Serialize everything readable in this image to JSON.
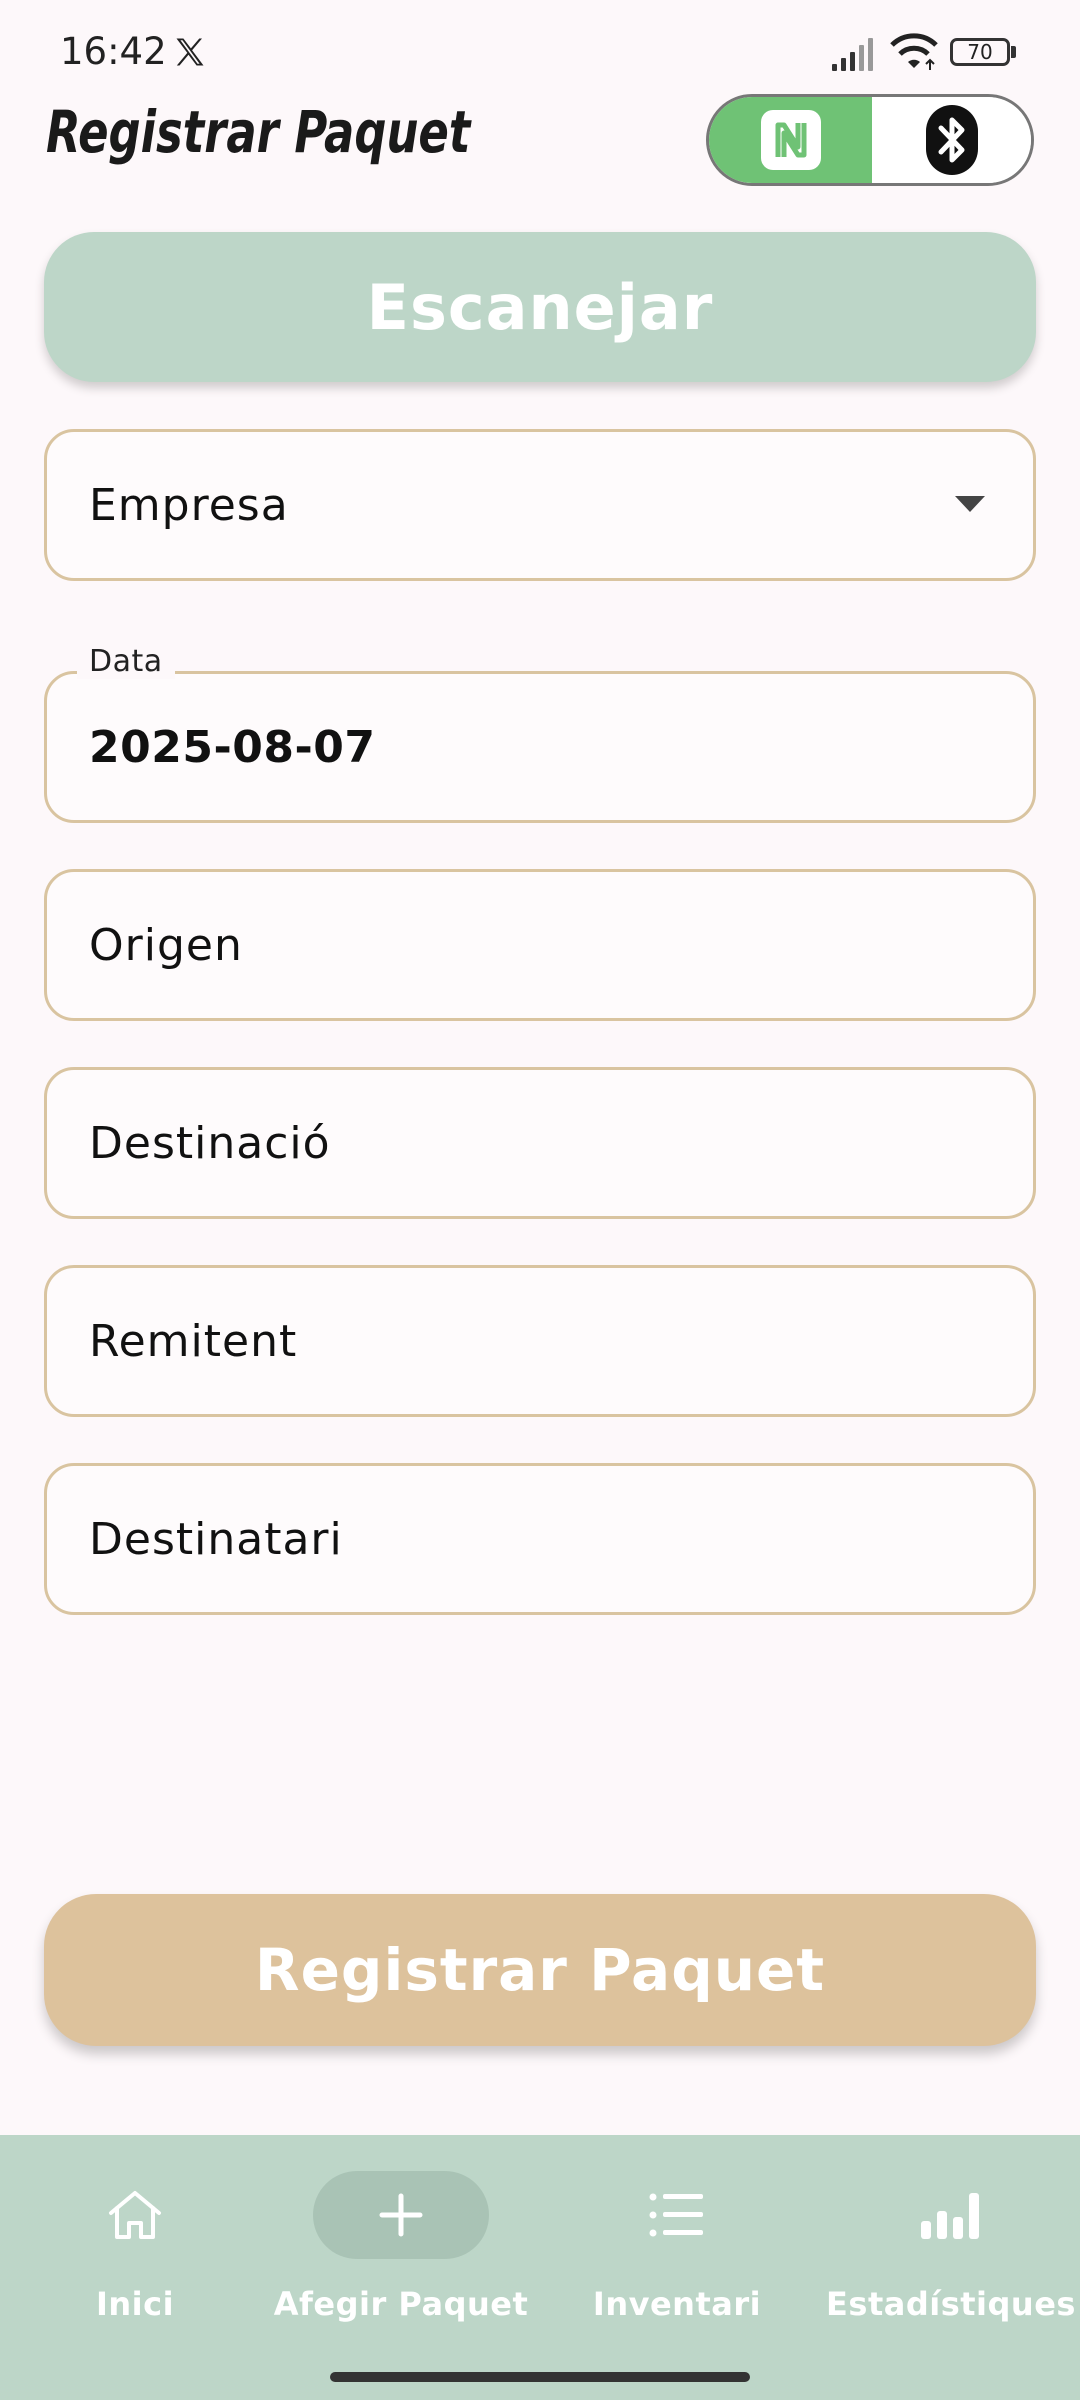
{
  "status_bar": {
    "time": "16:42",
    "battery": "70",
    "icons": [
      "x-app-icon",
      "signal-icon",
      "wifi-icon",
      "battery-icon"
    ]
  },
  "header": {
    "title": "Registrar Paquet",
    "toggle": {
      "left_icon": "nfc-icon",
      "right_icon": "bluetooth-icon",
      "selected": "nfc",
      "selected_color": "#6fc275"
    }
  },
  "scan_button": {
    "label": "Escanejar"
  },
  "form": {
    "company": {
      "placeholder": "Empresa"
    },
    "date": {
      "label": "Data",
      "value": "2025-08-07"
    },
    "origin": {
      "placeholder": "Origen"
    },
    "destination": {
      "placeholder": "Destinació"
    },
    "sender": {
      "placeholder": "Remitent"
    },
    "recipient": {
      "placeholder": "Destinatari"
    }
  },
  "register_button": {
    "label": "Registrar Paquet"
  },
  "bottom_nav": {
    "items": [
      {
        "label": "Inici",
        "icon": "home-icon"
      },
      {
        "label": "Afegir Paquet",
        "icon": "plus-icon",
        "active": true
      },
      {
        "label": "Inventari",
        "icon": "list-icon"
      },
      {
        "label": "Estadístiques",
        "icon": "bar-chart-icon"
      }
    ]
  },
  "colors": {
    "accent_green": "#bdd6c8",
    "accent_tan": "#ddc29c",
    "field_border": "#d9c4a0",
    "background": "#fdf8fa"
  }
}
